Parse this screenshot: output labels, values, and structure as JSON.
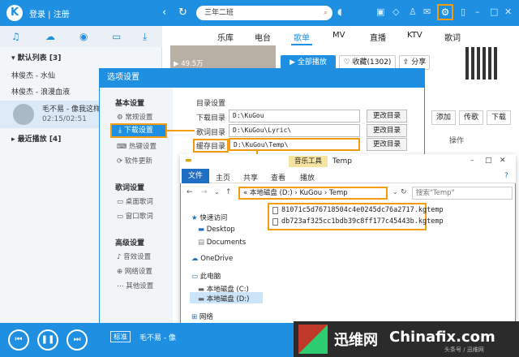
{
  "app": {
    "login_label": "登录",
    "register_label": "注册",
    "search_value": "三年二班",
    "main_tabs": [
      "乐库",
      "电台",
      "歌单",
      "MV",
      "直播",
      "KTV",
      "歌词"
    ]
  },
  "sidebar": {
    "default_list": "默认列表",
    "default_count": "[3]",
    "songs": [
      "林俊杰 - 水仙",
      "林俊杰 - 浪漫血液"
    ],
    "now_playing": "毛不易 - 像我这样",
    "now_time": "02:15/02:51",
    "recent": "最近播放",
    "recent_count": "[4]"
  },
  "page": {
    "play_count": "49.5万",
    "play_all": "全部播放",
    "favorite": "收藏(1302)",
    "share": "分享",
    "add_button": "添加",
    "upload_button": "传歌",
    "download_button": "下载",
    "ops_header": "操作"
  },
  "options_dialog": {
    "title": "选项设置",
    "basic_settings": "基本设置",
    "general": "常规设置",
    "download": "下载设置",
    "hotkeys": "热键设置",
    "software_update": "软件更新",
    "lyrics_settings": "歌词设置",
    "desktop_lyrics": "桌面歌词",
    "window_lyrics": "窗口歌词",
    "advanced": "高级设置",
    "sound": "音效设置",
    "network": "网络设置",
    "other": "其他设置",
    "dir_settings": "目录设置",
    "download_dir_label": "下载目录",
    "download_dir": "D:\\KuGou",
    "lyric_dir_label": "歌词目录",
    "lyric_dir": "D:\\KuGou\\Lyric\\",
    "cache_dir_label": "缓存目录",
    "cache_dir": "D:\\KuGou\\Temp\\",
    "change_dir": "更改目录"
  },
  "explorer": {
    "ctx_tab": "音乐工具",
    "title": "Temp",
    "tabs": [
      "文件",
      "主页",
      "共享",
      "查看",
      "播放"
    ],
    "address": [
      "本地磁盘 (D:)",
      "KuGou",
      "Temp"
    ],
    "search_placeholder": "搜索\"Temp\"",
    "tree": [
      "快速访问",
      "Desktop",
      "Documents",
      "OneDrive",
      "此电脑",
      "本地磁盘 (C:)",
      "本地磁盘 (D:)",
      "网络"
    ],
    "files": [
      "81071c5d76718504c4e0245dc76a2717.kgtemp",
      "db723af325cc1bdb39c8ff177c45443b.kgtemp"
    ]
  },
  "player": {
    "mode": "标准",
    "song": "毛不易 - 像"
  },
  "watermark": {
    "cn": "迅维网",
    "en": "Chinafix.com",
    "small": "头条号 / 迅维网"
  },
  "colors": {
    "accent": "#1f8fe1",
    "highlight": "#f39c12"
  }
}
